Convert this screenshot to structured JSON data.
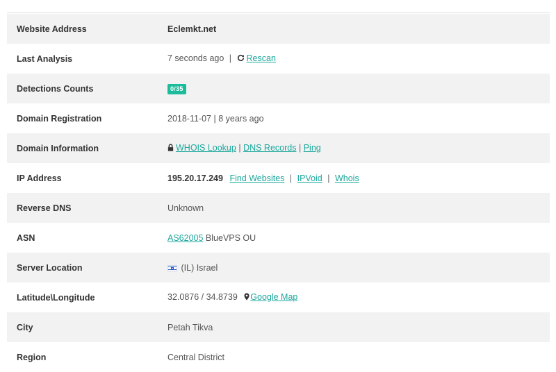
{
  "rows": {
    "website": {
      "label": "Website Address",
      "value": "Eclemkt.net"
    },
    "analysis": {
      "label": "Last Analysis",
      "value": "7 seconds ago",
      "sep": "|",
      "rescan": "Rescan"
    },
    "detections": {
      "label": "Detections Counts",
      "badge": "0/35"
    },
    "registration": {
      "label": "Domain Registration",
      "value": "2018-11-07 | 8 years ago"
    },
    "domain_info": {
      "label": "Domain Information",
      "whois_lookup": "WHOIS Lookup",
      "sep": "|",
      "dns_records": "DNS Records",
      "ping": "Ping"
    },
    "ip": {
      "label": "IP Address",
      "value": "195.20.17.249",
      "sep": "|",
      "find_websites": "Find Websites",
      "ipvoid": "IPVoid",
      "whois": "Whois"
    },
    "rdns": {
      "label": "Reverse DNS",
      "value": "Unknown"
    },
    "asn": {
      "label": "ASN",
      "asn_link": "AS62005",
      "provider": "BlueVPS OU"
    },
    "location": {
      "label": "Server Location",
      "value": "(IL) Israel"
    },
    "latlon": {
      "label": "Latitude\\Longitude",
      "value": "32.0876 / 34.8739",
      "map_link": "Google Map"
    },
    "city": {
      "label": "City",
      "value": "Petah Tikva"
    },
    "region": {
      "label": "Region",
      "value": "Central District"
    }
  },
  "icons": {
    "rescan": "refresh-icon",
    "lock": "lock-icon",
    "map": "map-marker-icon",
    "flag": "israel-flag-icon"
  },
  "colors": {
    "link": "#1aa79c",
    "badge": "#1abc9c",
    "stripe": "#f2f2f2"
  }
}
